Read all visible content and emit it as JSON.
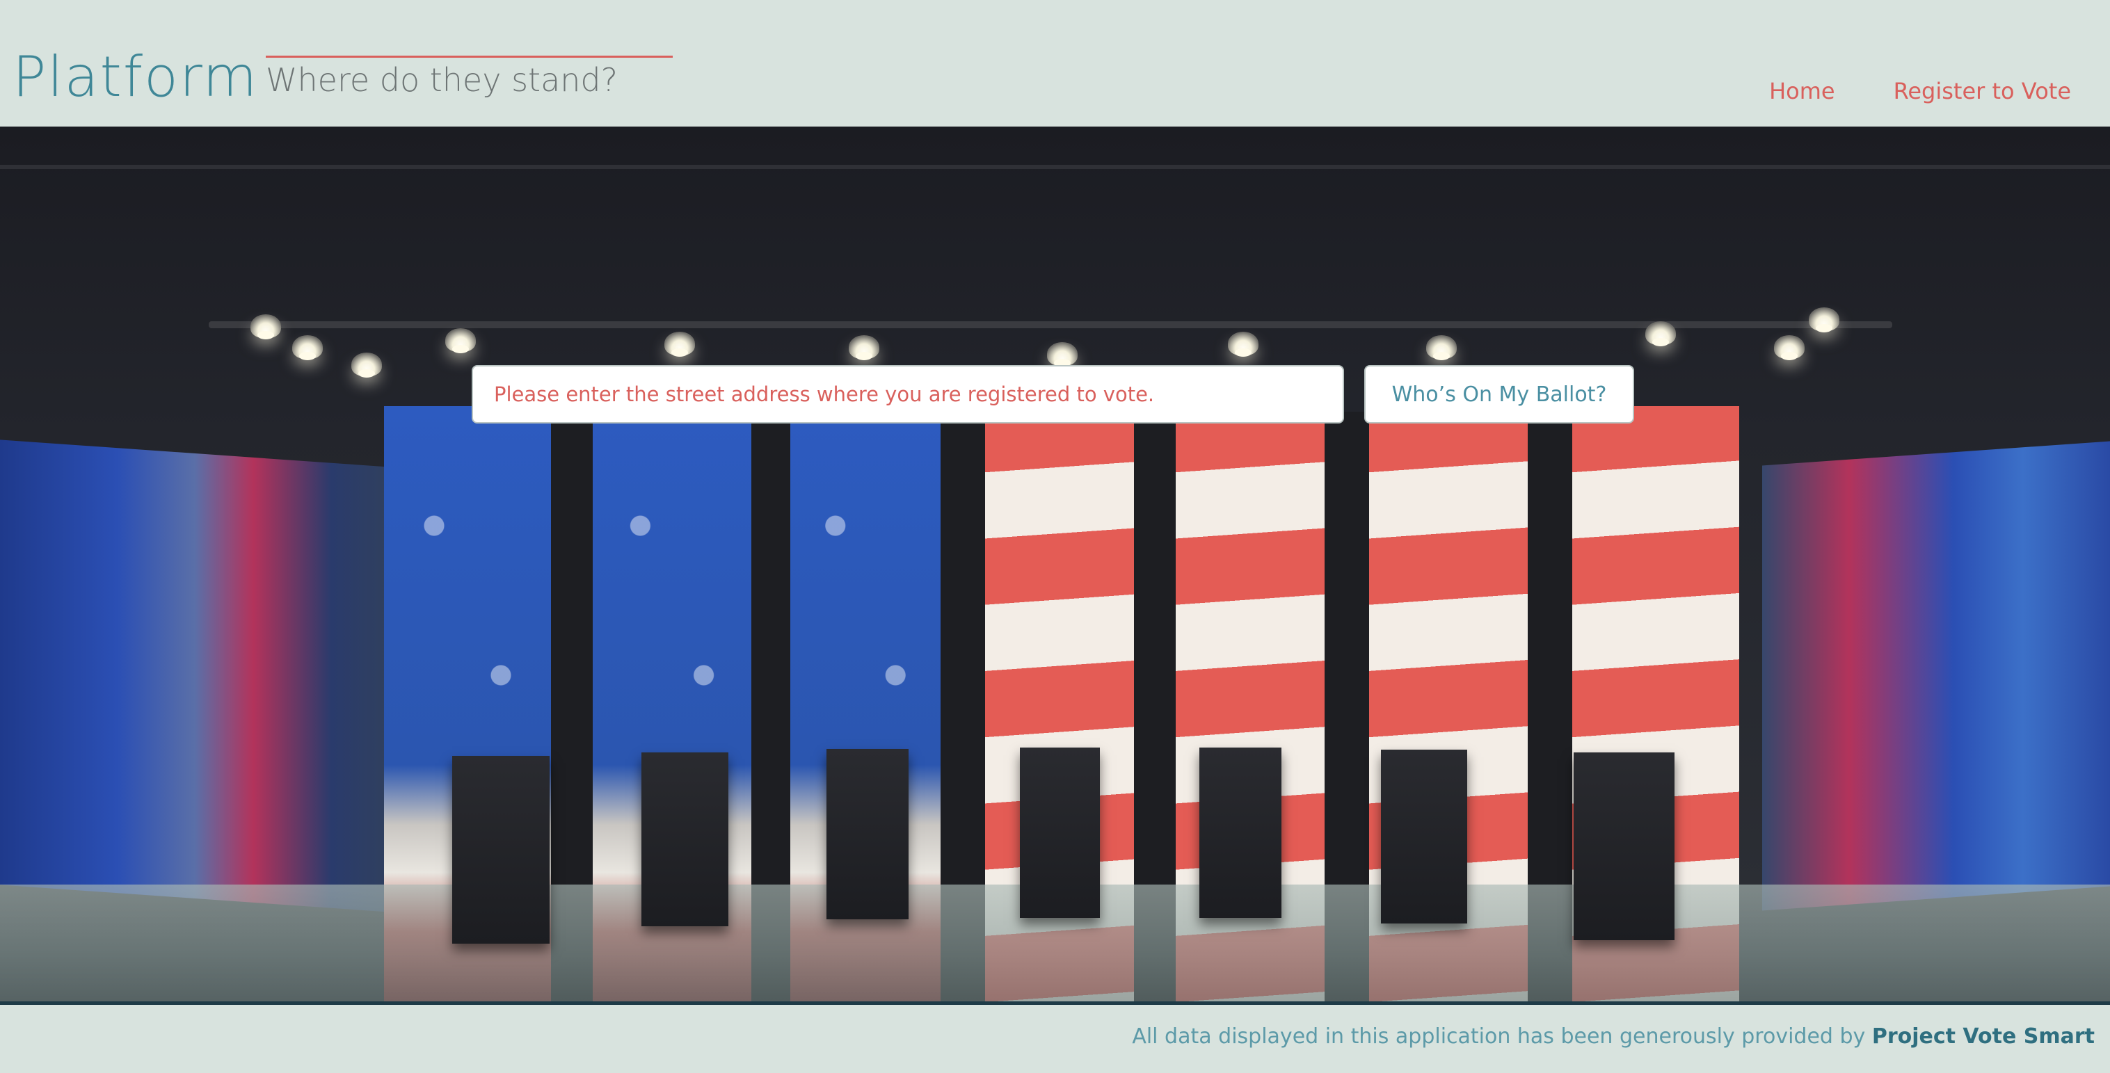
{
  "header": {
    "brand": "Platform",
    "tagline": "Where do they stand?",
    "nav": [
      {
        "label": "Home"
      },
      {
        "label": "Register to Vote"
      }
    ]
  },
  "search": {
    "placeholder": "Please enter the street address where you are registered to vote.",
    "button_label": "Who’s On My Ballot?"
  },
  "footer": {
    "text": "All data displayed in this application has been generously provided by",
    "link_label": "Project Vote Smart"
  },
  "colors": {
    "background": "#d8e3de",
    "brand": "#3f8797",
    "accent": "#d9605c",
    "footer_rule": "#1e3b47"
  }
}
